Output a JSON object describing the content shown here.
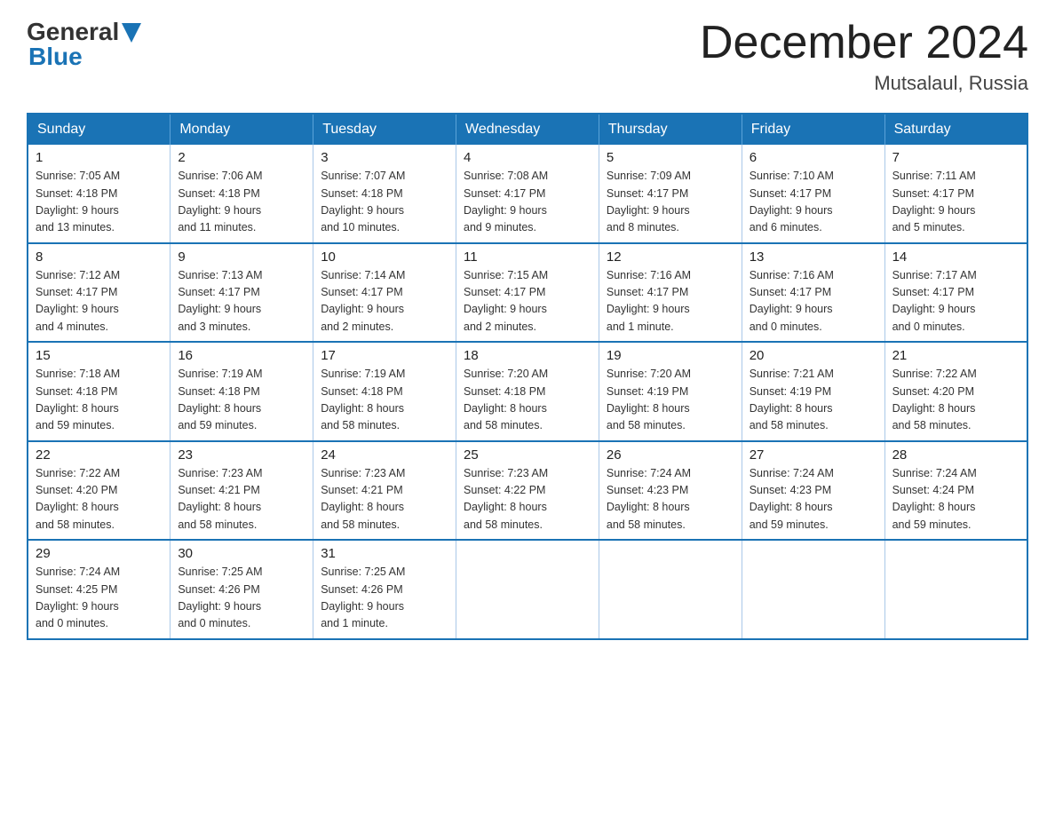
{
  "header": {
    "logo_general": "General",
    "logo_blue": "Blue",
    "month_title": "December 2024",
    "location": "Mutsalaul, Russia"
  },
  "weekdays": [
    "Sunday",
    "Monday",
    "Tuesday",
    "Wednesday",
    "Thursday",
    "Friday",
    "Saturday"
  ],
  "weeks": [
    [
      {
        "day": "1",
        "sunrise": "Sunrise: 7:05 AM",
        "sunset": "Sunset: 4:18 PM",
        "daylight": "Daylight: 9 hours",
        "daylight2": "and 13 minutes."
      },
      {
        "day": "2",
        "sunrise": "Sunrise: 7:06 AM",
        "sunset": "Sunset: 4:18 PM",
        "daylight": "Daylight: 9 hours",
        "daylight2": "and 11 minutes."
      },
      {
        "day": "3",
        "sunrise": "Sunrise: 7:07 AM",
        "sunset": "Sunset: 4:18 PM",
        "daylight": "Daylight: 9 hours",
        "daylight2": "and 10 minutes."
      },
      {
        "day": "4",
        "sunrise": "Sunrise: 7:08 AM",
        "sunset": "Sunset: 4:17 PM",
        "daylight": "Daylight: 9 hours",
        "daylight2": "and 9 minutes."
      },
      {
        "day": "5",
        "sunrise": "Sunrise: 7:09 AM",
        "sunset": "Sunset: 4:17 PM",
        "daylight": "Daylight: 9 hours",
        "daylight2": "and 8 minutes."
      },
      {
        "day": "6",
        "sunrise": "Sunrise: 7:10 AM",
        "sunset": "Sunset: 4:17 PM",
        "daylight": "Daylight: 9 hours",
        "daylight2": "and 6 minutes."
      },
      {
        "day": "7",
        "sunrise": "Sunrise: 7:11 AM",
        "sunset": "Sunset: 4:17 PM",
        "daylight": "Daylight: 9 hours",
        "daylight2": "and 5 minutes."
      }
    ],
    [
      {
        "day": "8",
        "sunrise": "Sunrise: 7:12 AM",
        "sunset": "Sunset: 4:17 PM",
        "daylight": "Daylight: 9 hours",
        "daylight2": "and 4 minutes."
      },
      {
        "day": "9",
        "sunrise": "Sunrise: 7:13 AM",
        "sunset": "Sunset: 4:17 PM",
        "daylight": "Daylight: 9 hours",
        "daylight2": "and 3 minutes."
      },
      {
        "day": "10",
        "sunrise": "Sunrise: 7:14 AM",
        "sunset": "Sunset: 4:17 PM",
        "daylight": "Daylight: 9 hours",
        "daylight2": "and 2 minutes."
      },
      {
        "day": "11",
        "sunrise": "Sunrise: 7:15 AM",
        "sunset": "Sunset: 4:17 PM",
        "daylight": "Daylight: 9 hours",
        "daylight2": "and 2 minutes."
      },
      {
        "day": "12",
        "sunrise": "Sunrise: 7:16 AM",
        "sunset": "Sunset: 4:17 PM",
        "daylight": "Daylight: 9 hours",
        "daylight2": "and 1 minute."
      },
      {
        "day": "13",
        "sunrise": "Sunrise: 7:16 AM",
        "sunset": "Sunset: 4:17 PM",
        "daylight": "Daylight: 9 hours",
        "daylight2": "and 0 minutes."
      },
      {
        "day": "14",
        "sunrise": "Sunrise: 7:17 AM",
        "sunset": "Sunset: 4:17 PM",
        "daylight": "Daylight: 9 hours",
        "daylight2": "and 0 minutes."
      }
    ],
    [
      {
        "day": "15",
        "sunrise": "Sunrise: 7:18 AM",
        "sunset": "Sunset: 4:18 PM",
        "daylight": "Daylight: 8 hours",
        "daylight2": "and 59 minutes."
      },
      {
        "day": "16",
        "sunrise": "Sunrise: 7:19 AM",
        "sunset": "Sunset: 4:18 PM",
        "daylight": "Daylight: 8 hours",
        "daylight2": "and 59 minutes."
      },
      {
        "day": "17",
        "sunrise": "Sunrise: 7:19 AM",
        "sunset": "Sunset: 4:18 PM",
        "daylight": "Daylight: 8 hours",
        "daylight2": "and 58 minutes."
      },
      {
        "day": "18",
        "sunrise": "Sunrise: 7:20 AM",
        "sunset": "Sunset: 4:18 PM",
        "daylight": "Daylight: 8 hours",
        "daylight2": "and 58 minutes."
      },
      {
        "day": "19",
        "sunrise": "Sunrise: 7:20 AM",
        "sunset": "Sunset: 4:19 PM",
        "daylight": "Daylight: 8 hours",
        "daylight2": "and 58 minutes."
      },
      {
        "day": "20",
        "sunrise": "Sunrise: 7:21 AM",
        "sunset": "Sunset: 4:19 PM",
        "daylight": "Daylight: 8 hours",
        "daylight2": "and 58 minutes."
      },
      {
        "day": "21",
        "sunrise": "Sunrise: 7:22 AM",
        "sunset": "Sunset: 4:20 PM",
        "daylight": "Daylight: 8 hours",
        "daylight2": "and 58 minutes."
      }
    ],
    [
      {
        "day": "22",
        "sunrise": "Sunrise: 7:22 AM",
        "sunset": "Sunset: 4:20 PM",
        "daylight": "Daylight: 8 hours",
        "daylight2": "and 58 minutes."
      },
      {
        "day": "23",
        "sunrise": "Sunrise: 7:23 AM",
        "sunset": "Sunset: 4:21 PM",
        "daylight": "Daylight: 8 hours",
        "daylight2": "and 58 minutes."
      },
      {
        "day": "24",
        "sunrise": "Sunrise: 7:23 AM",
        "sunset": "Sunset: 4:21 PM",
        "daylight": "Daylight: 8 hours",
        "daylight2": "and 58 minutes."
      },
      {
        "day": "25",
        "sunrise": "Sunrise: 7:23 AM",
        "sunset": "Sunset: 4:22 PM",
        "daylight": "Daylight: 8 hours",
        "daylight2": "and 58 minutes."
      },
      {
        "day": "26",
        "sunrise": "Sunrise: 7:24 AM",
        "sunset": "Sunset: 4:23 PM",
        "daylight": "Daylight: 8 hours",
        "daylight2": "and 58 minutes."
      },
      {
        "day": "27",
        "sunrise": "Sunrise: 7:24 AM",
        "sunset": "Sunset: 4:23 PM",
        "daylight": "Daylight: 8 hours",
        "daylight2": "and 59 minutes."
      },
      {
        "day": "28",
        "sunrise": "Sunrise: 7:24 AM",
        "sunset": "Sunset: 4:24 PM",
        "daylight": "Daylight: 8 hours",
        "daylight2": "and 59 minutes."
      }
    ],
    [
      {
        "day": "29",
        "sunrise": "Sunrise: 7:24 AM",
        "sunset": "Sunset: 4:25 PM",
        "daylight": "Daylight: 9 hours",
        "daylight2": "and 0 minutes."
      },
      {
        "day": "30",
        "sunrise": "Sunrise: 7:25 AM",
        "sunset": "Sunset: 4:26 PM",
        "daylight": "Daylight: 9 hours",
        "daylight2": "and 0 minutes."
      },
      {
        "day": "31",
        "sunrise": "Sunrise: 7:25 AM",
        "sunset": "Sunset: 4:26 PM",
        "daylight": "Daylight: 9 hours",
        "daylight2": "and 1 minute."
      },
      null,
      null,
      null,
      null
    ]
  ]
}
